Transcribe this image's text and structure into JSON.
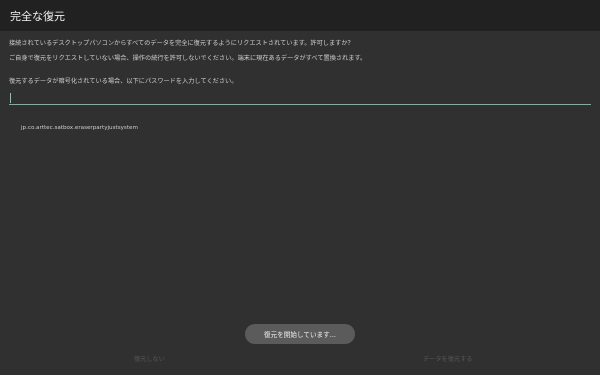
{
  "dialog": {
    "title": "完全な復元",
    "message_line1": "接続されているデスクトップパソコンからすべてのデータを完全に復元するようにリクエストされています。許可しますか？",
    "message_line2": "ご自身で復元をリクエストしていない場合、操作の続行を許可しないでください。端末に現在あるデータがすべて置換されます。",
    "message_line3": "復元するデータが暗号化されている場合、以下にパスワードを入力してください。",
    "password_value": "",
    "package_name": "jp.co.arttec.satbox.eraserpartyjustsystem",
    "toast": "復元を開始しています...",
    "deny_button": "復元しない",
    "restore_button": "データを復元する"
  },
  "colors": {
    "background": "#303030",
    "title_bar": "#212121",
    "accent": "#6fb6a8",
    "toast": "#5b5b5b",
    "disabled_button_text": "#575757"
  }
}
